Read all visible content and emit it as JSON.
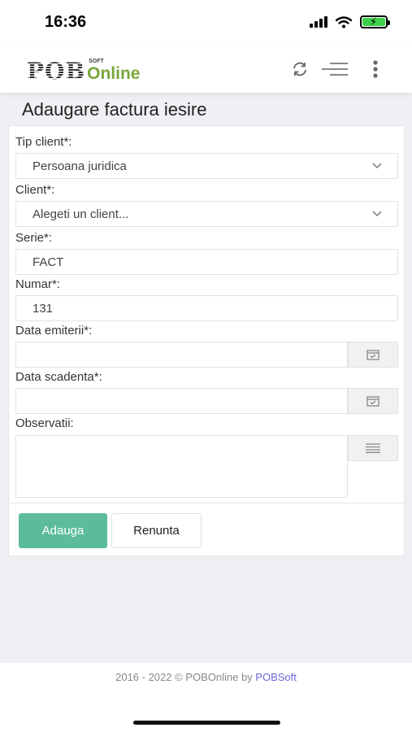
{
  "status_bar": {
    "time": "16:36"
  },
  "header": {
    "logo_main": "POB",
    "logo_soft": "SOFT",
    "logo_online": "Online",
    "icons": [
      "refresh-icon",
      "menu-icon",
      "kebab-menu-icon"
    ]
  },
  "page": {
    "title": "Adaugare factura iesire"
  },
  "form": {
    "tip_client": {
      "label": "Tip client*:",
      "value": "Persoana juridica"
    },
    "client": {
      "label": "Client*:",
      "placeholder": "Alegeti un client..."
    },
    "serie": {
      "label": "Serie*:",
      "value": "FACT"
    },
    "numar": {
      "label": "Numar*:",
      "value": "131"
    },
    "data_emiterii": {
      "label": "Data emiterii*:",
      "value": ""
    },
    "data_scadenta": {
      "label": "Data scadenta*:",
      "value": ""
    },
    "observatii": {
      "label": "Observatii:",
      "value": ""
    }
  },
  "buttons": {
    "add": "Adauga",
    "cancel": "Renunta"
  },
  "footer": {
    "text": "2016 - 2022 © POBOnline by ",
    "link": "POBSoft"
  },
  "colors": {
    "primary": "#5cbc9a",
    "logo_green": "#7aa63a",
    "link": "#6a6ad8"
  }
}
